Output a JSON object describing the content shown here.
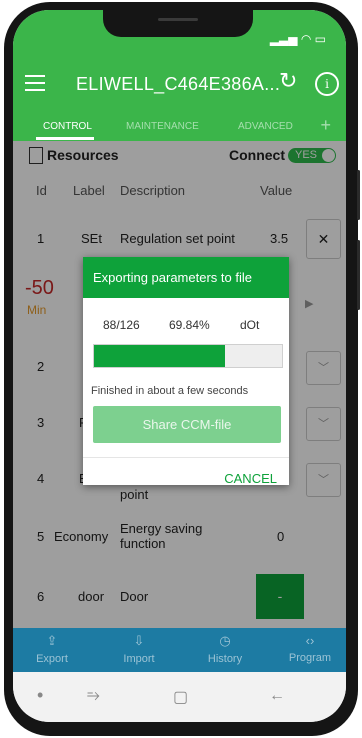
{
  "app": {
    "title": "ELIWELL_C464E386A...",
    "tabs": [
      "CONTROL",
      "MAINTENANCE",
      "ADVANCED"
    ],
    "add_tab_symbol": "+"
  },
  "resources": {
    "label": "Resources",
    "connect_label": "Connect",
    "toggle_text": "YES"
  },
  "table": {
    "headers": {
      "id": "Id",
      "label": "Label",
      "description": "Description",
      "value": "Value"
    },
    "row1": {
      "id": "1",
      "label": "SEt",
      "description": "Regulation set point",
      "value": "3.5"
    },
    "row2": {
      "big_value": "-50",
      "sub": "Min"
    },
    "row3": {
      "id": "2"
    },
    "row4": {
      "id": "3",
      "label_fragment": "F"
    },
    "row5": {
      "id": "4",
      "label_fragment": "E",
      "description_fragment": "point"
    },
    "row6": {
      "id": "5",
      "label": "Economy",
      "description": "Energy saving function",
      "value": "0"
    },
    "row7": {
      "id": "6",
      "label": "door",
      "description": "Door",
      "value": "-"
    }
  },
  "dialog": {
    "title": "Exporting parameters to file",
    "count": "88/126",
    "percent": "69.84%",
    "unit": "dOt",
    "progress": 0.6984,
    "message": "Finished in about a few seconds",
    "share_button": "Share CCM-file",
    "cancel_button": "CANCEL"
  },
  "bottom_nav": {
    "export": "Export",
    "import": "Import",
    "history": "History",
    "program": "Program"
  },
  "colors": {
    "primary_green": "#3bb54a",
    "dialog_green": "#0ea23a",
    "bottom_bar_blue": "#1d7ba3",
    "alert_red": "#c62828",
    "min_orange": "#e69a2a"
  }
}
